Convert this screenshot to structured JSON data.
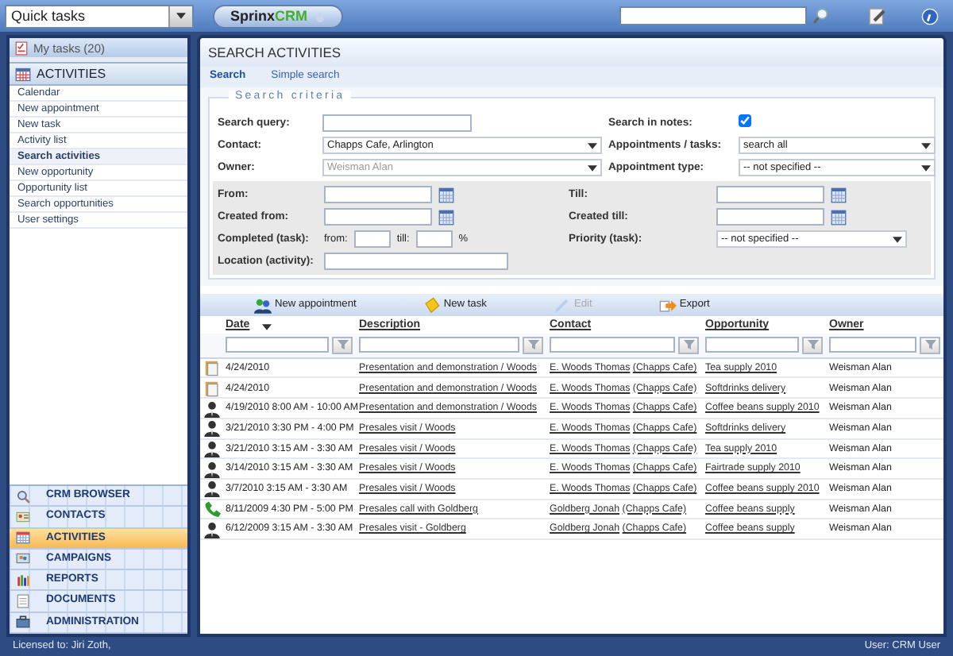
{
  "quick_tasks": {
    "value": "Quick tasks"
  },
  "logo": {
    "name": "Sprinx",
    "suffix": "CRM"
  },
  "sidebar": {
    "my_tasks": "My tasks (20)",
    "section": "ACTIVITIES",
    "items": [
      {
        "label": "Calendar",
        "selected": false
      },
      {
        "label": "New appointment",
        "selected": false
      },
      {
        "label": "New task",
        "selected": false
      },
      {
        "label": "Activity list",
        "selected": false
      },
      {
        "label": "Search activities",
        "selected": true
      },
      {
        "label": "New opportunity",
        "selected": false
      },
      {
        "label": "Opportunity list",
        "selected": false
      },
      {
        "label": "Search opportunities",
        "selected": false
      },
      {
        "label": "User settings",
        "selected": false
      }
    ],
    "modules": [
      {
        "label": "CRM BROWSER",
        "selected": false
      },
      {
        "label": "CONTACTS",
        "selected": false
      },
      {
        "label": "ACTIVITIES",
        "selected": true
      },
      {
        "label": "CAMPAIGNS",
        "selected": false
      },
      {
        "label": "REPORTS",
        "selected": false
      },
      {
        "label": "DOCUMENTS",
        "selected": false
      },
      {
        "label": "ADMINISTRATION",
        "selected": false
      }
    ]
  },
  "page": {
    "title": "SEARCH ACTIVITIES",
    "tabs": [
      {
        "label": "Search",
        "selected": true
      },
      {
        "label": "Simple search",
        "selected": false
      }
    ]
  },
  "criteria": {
    "legend": "Search criteria",
    "top_rows": [
      [
        {
          "label": "Search query:",
          "kind": "text"
        },
        {
          "label": "Search in notes:",
          "kind": "checkbox",
          "checked": true
        }
      ],
      [
        {
          "label": "Contact:",
          "kind": "select",
          "value": "Chapps Cafe, Arlington",
          "disabled": false
        },
        {
          "label": "Appointments / tasks:",
          "kind": "select",
          "value": "search all",
          "disabled": false
        }
      ],
      [
        {
          "label": "Owner:",
          "kind": "select",
          "value": "Weisman Alan",
          "disabled": true
        },
        {
          "label": "Appointment type:",
          "kind": "select",
          "value": "-- not specified --",
          "disabled": false
        }
      ]
    ],
    "detail_rows": [
      [
        {
          "label": "From:",
          "kind": "date"
        },
        {
          "label": "Till:",
          "kind": "date"
        }
      ],
      [
        {
          "label": "Created from:",
          "kind": "date"
        },
        {
          "label": "Created till:",
          "kind": "date"
        }
      ],
      [
        {
          "label": "Completed (task):",
          "kind": "range",
          "from_label": "from:",
          "till_label": "till:",
          "unit": "%"
        },
        {
          "label": "Priority (task):",
          "kind": "select",
          "value": "-- not specified --",
          "disabled": false
        }
      ],
      [
        {
          "label": "Location (activity):",
          "kind": "text"
        }
      ]
    ]
  },
  "toolbar": [
    {
      "label": "New appointment",
      "disabled": false
    },
    {
      "label": "New task",
      "disabled": false
    },
    {
      "label": "Edit",
      "disabled": true
    },
    {
      "label": "Export",
      "disabled": false
    }
  ],
  "table": {
    "columns": [
      {
        "label": "Date",
        "sorted": true
      },
      {
        "label": "Description",
        "sorted": false
      },
      {
        "label": "Contact",
        "sorted": false
      },
      {
        "label": "Opportunity",
        "sorted": false
      },
      {
        "label": "Owner",
        "sorted": false
      }
    ],
    "rows": [
      {
        "kind": "task",
        "date": "4/24/2010",
        "description": "Presentation and demonstration / Woods",
        "contact": "E. Woods Thomas",
        "company": "(Chapps Cafe)",
        "opportunity": "Tea supply 2010",
        "owner": "Weisman Alan"
      },
      {
        "kind": "task",
        "date": "4/24/2010",
        "description": "Presentation and demonstration / Woods",
        "contact": "E. Woods Thomas",
        "company": "(Chapps Cafe)",
        "opportunity": "Softdrinks delivery",
        "owner": "Weisman Alan"
      },
      {
        "kind": "meeting",
        "date": "4/19/2010 8:00 AM - 10:00 AM",
        "description": "Presentation and demonstration / Woods",
        "contact": "E. Woods Thomas",
        "company": "(Chapps Cafe)",
        "opportunity": "Coffee beans supply 2010",
        "owner": "Weisman Alan"
      },
      {
        "kind": "meeting",
        "date": "3/21/2010 3:30 PM - 4:00 PM",
        "description": "Presales visit / Woods",
        "contact": "E. Woods Thomas",
        "company": "(Chapps Cafe)",
        "opportunity": "Softdrinks delivery",
        "owner": "Weisman Alan"
      },
      {
        "kind": "meeting",
        "date": "3/21/2010 3:15 AM - 3:30 AM",
        "description": "Presales visit / Woods",
        "contact": "E. Woods Thomas",
        "company": "(Chapps Cafe)",
        "opportunity": "Tea supply 2010",
        "owner": "Weisman Alan"
      },
      {
        "kind": "meeting",
        "date": "3/14/2010 3:15 AM - 3:30 AM",
        "description": "Presales visit / Woods",
        "contact": "E. Woods Thomas",
        "company": "(Chapps Cafe)",
        "opportunity": "Fairtrade supply 2010",
        "owner": "Weisman Alan"
      },
      {
        "kind": "meeting",
        "date": "3/7/2010 3:15 AM - 3:30 AM",
        "description": "Presales visit / Woods",
        "contact": "E. Woods Thomas",
        "company": "(Chapps Cafe)",
        "opportunity": "Coffee beans supply 2010",
        "owner": "Weisman Alan"
      },
      {
        "kind": "call",
        "date": "8/11/2009 4:30 PM - 5:00 PM",
        "description": "Presales call with Goldberg",
        "contact": "Goldberg Jonah",
        "company": "(Chapps Cafe)",
        "opportunity": "Coffee beans supply",
        "owner": "Weisman Alan"
      },
      {
        "kind": "meeting",
        "date": "6/12/2009 3:15 AM - 3:30 AM",
        "description": "Presales visit - Goldberg",
        "contact": "Goldberg Jonah",
        "company": "(Chapps Cafe)",
        "opportunity": "Coffee beans supply",
        "owner": "Weisman Alan"
      }
    ]
  },
  "status_bar": {
    "license": "Licensed to: Jiri Zoth,",
    "user": "User: CRM User"
  }
}
